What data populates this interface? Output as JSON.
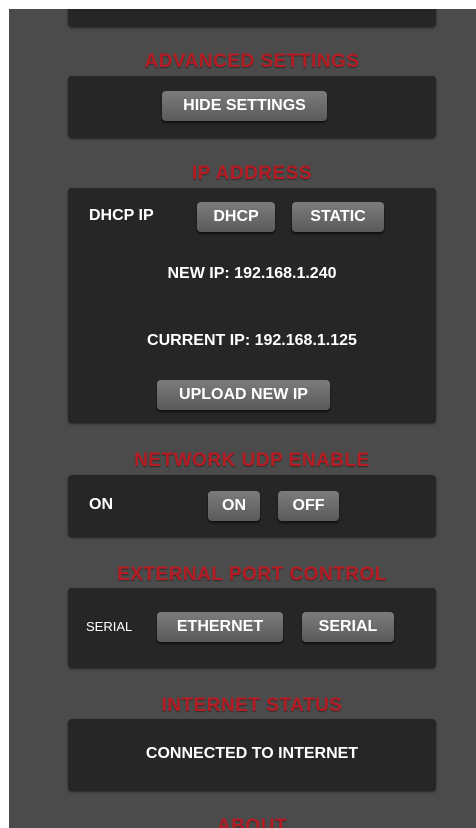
{
  "advanced": {
    "heading": "ADVANCED SETTINGS",
    "hide_button": "HIDE SETTINGS"
  },
  "ip": {
    "heading": "IP ADDRESS",
    "mode_label": "DHCP IP",
    "dhcp_button": "DHCP",
    "static_button": "STATIC",
    "new_ip_label": "NEW IP:",
    "new_ip_value": "192.168.1.240",
    "current_ip_label": "CURRENT IP:",
    "current_ip_value": "192.168.1.125",
    "upload_button": "UPLOAD NEW IP"
  },
  "udp": {
    "heading": "NETWORK UDP ENABLE",
    "state_label": "ON",
    "on_button": "ON",
    "off_button": "OFF"
  },
  "port": {
    "heading": "EXTERNAL PORT CONTROL",
    "state_label": "SERIAL",
    "ethernet_button": "ETHERNET",
    "serial_button": "SERIAL"
  },
  "internet": {
    "heading": "INTERNET STATUS",
    "status_text": "CONNECTED TO INTERNET"
  },
  "about": {
    "heading": "ABOUT"
  },
  "colors": {
    "heading_red": "#b51c24",
    "panel": "#262626",
    "background": "#4b4b4b"
  }
}
